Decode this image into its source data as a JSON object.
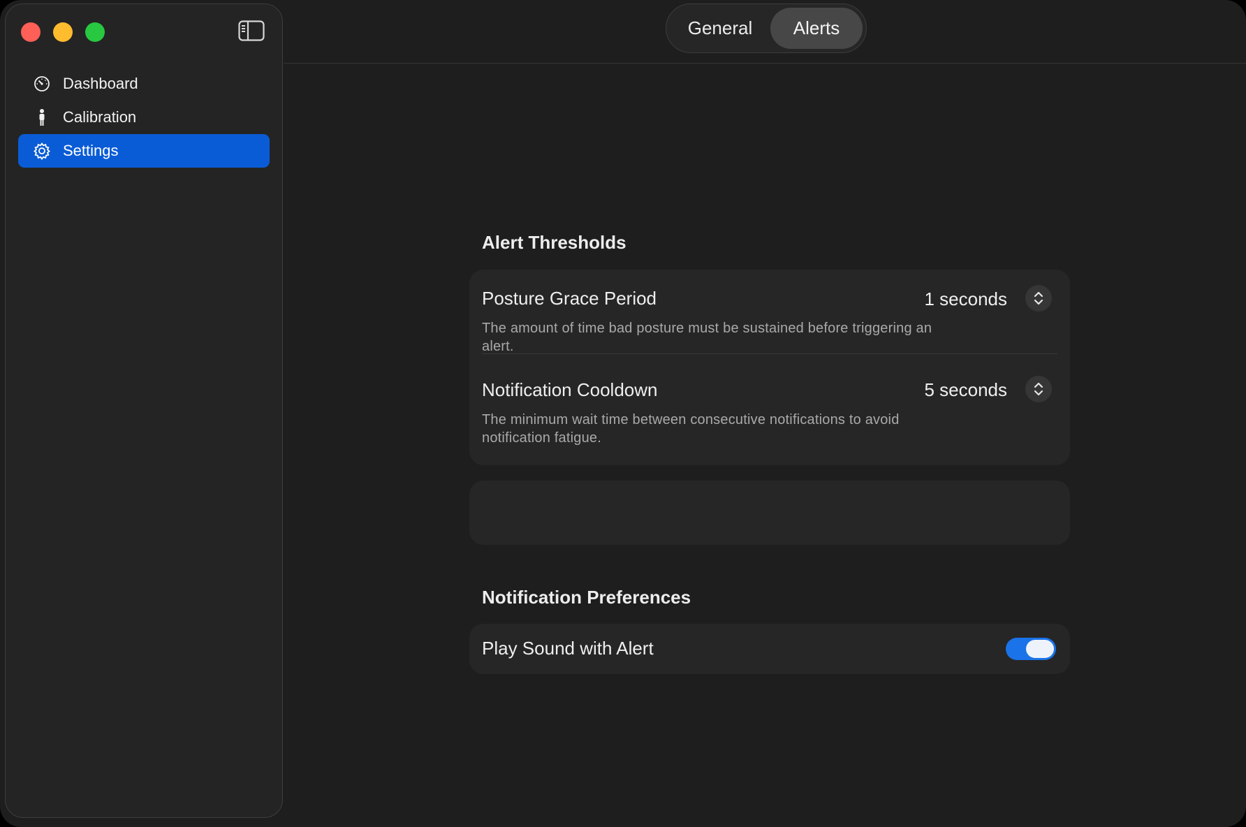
{
  "window": {
    "traffic_lights": {
      "close": "#fe5f57",
      "minimize": "#febc2e",
      "zoom": "#28c840"
    },
    "sidebar_toggle_icon": "sidebar-left-icon"
  },
  "sidebar": {
    "items": [
      {
        "label": "Dashboard",
        "icon": "gauge-icon",
        "active": false
      },
      {
        "label": "Calibration",
        "icon": "person-icon",
        "active": false
      },
      {
        "label": "Settings",
        "icon": "gear-icon",
        "active": true
      }
    ],
    "accent": "#0a5cd6"
  },
  "toolbar": {
    "tabs": [
      {
        "label": "General",
        "selected": false
      },
      {
        "label": "Alerts",
        "selected": true
      }
    ]
  },
  "alert_thresholds": {
    "title": "Alert Thresholds",
    "rows": [
      {
        "title": "Posture Grace Period",
        "value": "1 seconds",
        "description": "The amount of time bad posture must be sustained before triggering an alert."
      },
      {
        "title": "Notification Cooldown",
        "value": "5 seconds",
        "description": "The minimum wait time between consecutive notifications to avoid notification fatigue."
      }
    ]
  },
  "notification_preferences": {
    "title": "Notification Preferences",
    "play_sound": {
      "label": "Play Sound with Alert",
      "enabled": true,
      "color": "#1a73e8"
    }
  }
}
